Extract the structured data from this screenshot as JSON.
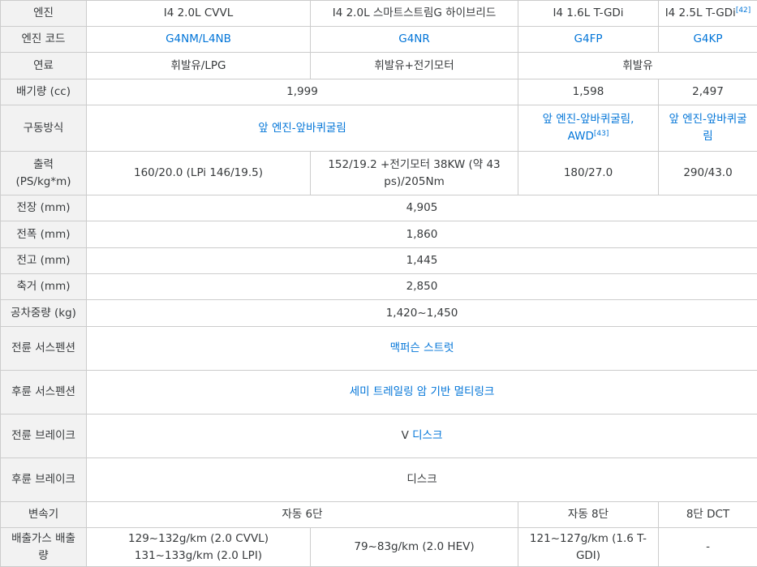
{
  "table": {
    "engine": {
      "label": "엔진",
      "c1": "I4 2.0L CVVL",
      "c2": "I4 2.0L 스마트스트림G 하이브리드",
      "c3": "I4 1.6L T-GDi",
      "c4": "I4 2.5L T-GDi",
      "c4_ref": "[42]"
    },
    "engine_code": {
      "label": "엔진 코드",
      "c1": "G4NM/L4NB",
      "c2": "G4NR",
      "c3": "G4FP",
      "c4": "G4KP"
    },
    "fuel": {
      "label": "연료",
      "c12": "휘발유/LPG",
      "c2": "휘발유+전기모터",
      "c34": "휘발유"
    },
    "displacement": {
      "label": "배기량 (cc)",
      "c12": "1,999",
      "c3": "1,598",
      "c4": "2,497"
    },
    "drive": {
      "label": "구동방식",
      "c12": "앞 엔진-앞바퀴굴림",
      "c3": "앞 엔진-앞바퀴굴림, AWD",
      "c3_ref": "[43]",
      "c4": "앞 엔진-앞바퀴굴림"
    },
    "power": {
      "label": "출력 (PS/kg*m)",
      "c1": "160/20.0 (LPi 146/19.5)",
      "c2": "152/19.2 +전기모터 38KW (약 43 ps)/205Nm",
      "c3": "180/27.0",
      "c4": "290/43.0"
    },
    "length": {
      "label": "전장 (mm)",
      "value": "4,905"
    },
    "width": {
      "label": "전폭 (mm)",
      "value": "1,860"
    },
    "height": {
      "label": "전고 (mm)",
      "value": "1,445"
    },
    "wheelbase": {
      "label": "축거 (mm)",
      "value": "2,850"
    },
    "curb_weight": {
      "label": "공차중량 (kg)",
      "value": "1,420~1,450"
    },
    "front_suspension": {
      "label": "전륜 서스펜션",
      "value": "맥퍼슨 스트럿"
    },
    "rear_suspension": {
      "label": "후륜 서스펜션",
      "value": "세미 트레일링 암 기반 멀티링크"
    },
    "front_brake": {
      "label": "전륜 브레이크",
      "prefix": "V",
      "link": "디스크"
    },
    "rear_brake": {
      "label": "후륜 브레이크",
      "value": "디스크"
    },
    "transmission": {
      "label": "변속기",
      "c12": "자동 6단",
      "c3": "자동 8단",
      "c4": "8단 DCT"
    },
    "emission": {
      "label": "배출가스 배출량",
      "c1": "129~132g/km (2.0 CVVL) 131~133g/km (2.0 LPI)",
      "c2": "79~83g/km (2.0 HEV)",
      "c3": "121~127g/km (1.6 T-GDI)",
      "c4": "-"
    }
  }
}
